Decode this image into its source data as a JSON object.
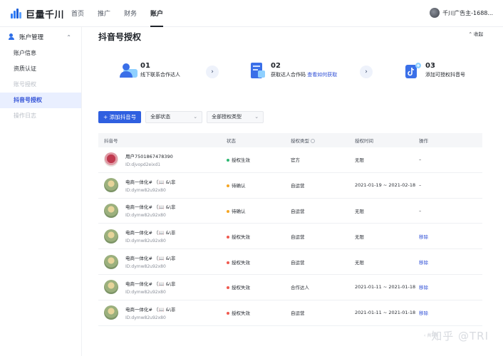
{
  "app": {
    "logo_text": "巨量千川",
    "account": "千川广告主-1688..."
  },
  "nav": {
    "items": [
      "首页",
      "推广",
      "财务",
      "账户"
    ],
    "active_index": 3
  },
  "sidebar": {
    "group_label": "账户管理",
    "items": [
      {
        "label": "账户信息",
        "state": "normal"
      },
      {
        "label": "资质认证",
        "state": "normal"
      },
      {
        "label": "账号授权",
        "state": "disabled"
      },
      {
        "label": "抖音号授权",
        "state": "active"
      },
      {
        "label": "操作日志",
        "state": "disabled"
      }
    ]
  },
  "main": {
    "title": "抖音号授权",
    "collapse_label": "收起",
    "steps": [
      {
        "num": "01",
        "text": "线下联系合作达人"
      },
      {
        "num": "02",
        "text": "获取达人合作码",
        "link": "查看如何获取"
      },
      {
        "num": "03",
        "text": "添加可授权抖音号"
      }
    ],
    "toolbar": {
      "add_button": "+ 添加抖音号",
      "status_select": "全部状态",
      "type_select": "全部授权类型"
    },
    "table": {
      "headers": [
        "抖音号",
        "状态",
        "授权类型",
        "授权时间",
        "操作"
      ],
      "rows": [
        {
          "name": "用户7501867478390",
          "id": "ID:djvopd2eixd1",
          "status": "授权生效",
          "type": "官方",
          "time": "无限",
          "action": "–",
          "avatar": "rose"
        },
        {
          "name": "电商一体化# 〔📖 &\\非",
          "id": "ID:dymw82u92x80",
          "status": "待确认",
          "type": "自运营",
          "time": "2021-01-19 ~ 2021-02-18",
          "action": "–",
          "avatar": "green"
        },
        {
          "name": "电商一体化# 〔📖 &\\非",
          "id": "ID:dymw82u92x80",
          "status": "待确认",
          "type": "自运营",
          "time": "无限",
          "action": "–",
          "avatar": "green"
        },
        {
          "name": "电商一体化# 〔📖 &\\非",
          "id": "ID:dymw82u92x80",
          "status": "授权失效",
          "type": "自运营",
          "time": "无限",
          "action": "移除",
          "avatar": "green"
        },
        {
          "name": "电商一体化# 〔📖 &\\非",
          "id": "ID:dymw82u92x80",
          "status": "授权失效",
          "type": "自运营",
          "time": "无限",
          "action": "移除",
          "avatar": "green"
        },
        {
          "name": "电商一体化# 〔📖 &\\非",
          "id": "ID:dymw82u92x80",
          "status": "授权失效",
          "type": "合作达人",
          "time": "2021-01-11 ~ 2021-01-18",
          "action": "移除",
          "avatar": "green"
        },
        {
          "name": "电商一体化# 〔📖 &\\非",
          "id": "ID:dymw82u92x80",
          "status": "授权失效",
          "type": "自运营",
          "time": "2021-01-11 ~ 2021-01-18",
          "action": "移除",
          "avatar": "green"
        }
      ]
    }
  },
  "colors": {
    "status": {
      "授权生效": "#2eb872",
      "待确认": "#f5a623",
      "授权失效": "#f05a4f"
    },
    "primary": "#2f5fe0"
  },
  "watermark": "知乎 @TRI"
}
